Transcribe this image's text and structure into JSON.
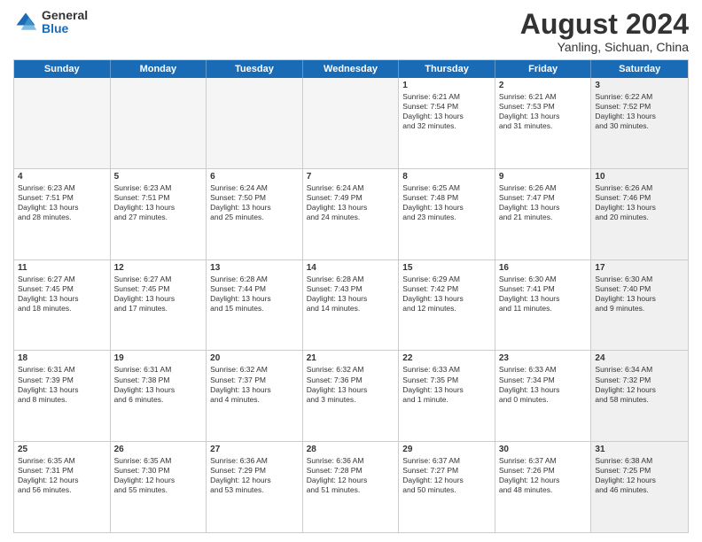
{
  "logo": {
    "general": "General",
    "blue": "Blue"
  },
  "title": "August 2024",
  "location": "Yanling, Sichuan, China",
  "days_of_week": [
    "Sunday",
    "Monday",
    "Tuesday",
    "Wednesday",
    "Thursday",
    "Friday",
    "Saturday"
  ],
  "rows": [
    [
      {
        "day": "",
        "text": "",
        "empty": true
      },
      {
        "day": "",
        "text": "",
        "empty": true
      },
      {
        "day": "",
        "text": "",
        "empty": true
      },
      {
        "day": "",
        "text": "",
        "empty": true
      },
      {
        "day": "1",
        "text": "Sunrise: 6:21 AM\nSunset: 7:54 PM\nDaylight: 13 hours\nand 32 minutes."
      },
      {
        "day": "2",
        "text": "Sunrise: 6:21 AM\nSunset: 7:53 PM\nDaylight: 13 hours\nand 31 minutes."
      },
      {
        "day": "3",
        "text": "Sunrise: 6:22 AM\nSunset: 7:52 PM\nDaylight: 13 hours\nand 30 minutes.",
        "shaded": true
      }
    ],
    [
      {
        "day": "4",
        "text": "Sunrise: 6:23 AM\nSunset: 7:51 PM\nDaylight: 13 hours\nand 28 minutes."
      },
      {
        "day": "5",
        "text": "Sunrise: 6:23 AM\nSunset: 7:51 PM\nDaylight: 13 hours\nand 27 minutes."
      },
      {
        "day": "6",
        "text": "Sunrise: 6:24 AM\nSunset: 7:50 PM\nDaylight: 13 hours\nand 25 minutes."
      },
      {
        "day": "7",
        "text": "Sunrise: 6:24 AM\nSunset: 7:49 PM\nDaylight: 13 hours\nand 24 minutes."
      },
      {
        "day": "8",
        "text": "Sunrise: 6:25 AM\nSunset: 7:48 PM\nDaylight: 13 hours\nand 23 minutes."
      },
      {
        "day": "9",
        "text": "Sunrise: 6:26 AM\nSunset: 7:47 PM\nDaylight: 13 hours\nand 21 minutes."
      },
      {
        "day": "10",
        "text": "Sunrise: 6:26 AM\nSunset: 7:46 PM\nDaylight: 13 hours\nand 20 minutes.",
        "shaded": true
      }
    ],
    [
      {
        "day": "11",
        "text": "Sunrise: 6:27 AM\nSunset: 7:45 PM\nDaylight: 13 hours\nand 18 minutes."
      },
      {
        "day": "12",
        "text": "Sunrise: 6:27 AM\nSunset: 7:45 PM\nDaylight: 13 hours\nand 17 minutes."
      },
      {
        "day": "13",
        "text": "Sunrise: 6:28 AM\nSunset: 7:44 PM\nDaylight: 13 hours\nand 15 minutes."
      },
      {
        "day": "14",
        "text": "Sunrise: 6:28 AM\nSunset: 7:43 PM\nDaylight: 13 hours\nand 14 minutes."
      },
      {
        "day": "15",
        "text": "Sunrise: 6:29 AM\nSunset: 7:42 PM\nDaylight: 13 hours\nand 12 minutes."
      },
      {
        "day": "16",
        "text": "Sunrise: 6:30 AM\nSunset: 7:41 PM\nDaylight: 13 hours\nand 11 minutes."
      },
      {
        "day": "17",
        "text": "Sunrise: 6:30 AM\nSunset: 7:40 PM\nDaylight: 13 hours\nand 9 minutes.",
        "shaded": true
      }
    ],
    [
      {
        "day": "18",
        "text": "Sunrise: 6:31 AM\nSunset: 7:39 PM\nDaylight: 13 hours\nand 8 minutes."
      },
      {
        "day": "19",
        "text": "Sunrise: 6:31 AM\nSunset: 7:38 PM\nDaylight: 13 hours\nand 6 minutes."
      },
      {
        "day": "20",
        "text": "Sunrise: 6:32 AM\nSunset: 7:37 PM\nDaylight: 13 hours\nand 4 minutes."
      },
      {
        "day": "21",
        "text": "Sunrise: 6:32 AM\nSunset: 7:36 PM\nDaylight: 13 hours\nand 3 minutes."
      },
      {
        "day": "22",
        "text": "Sunrise: 6:33 AM\nSunset: 7:35 PM\nDaylight: 13 hours\nand 1 minute."
      },
      {
        "day": "23",
        "text": "Sunrise: 6:33 AM\nSunset: 7:34 PM\nDaylight: 13 hours\nand 0 minutes."
      },
      {
        "day": "24",
        "text": "Sunrise: 6:34 AM\nSunset: 7:32 PM\nDaylight: 12 hours\nand 58 minutes.",
        "shaded": true
      }
    ],
    [
      {
        "day": "25",
        "text": "Sunrise: 6:35 AM\nSunset: 7:31 PM\nDaylight: 12 hours\nand 56 minutes."
      },
      {
        "day": "26",
        "text": "Sunrise: 6:35 AM\nSunset: 7:30 PM\nDaylight: 12 hours\nand 55 minutes."
      },
      {
        "day": "27",
        "text": "Sunrise: 6:36 AM\nSunset: 7:29 PM\nDaylight: 12 hours\nand 53 minutes."
      },
      {
        "day": "28",
        "text": "Sunrise: 6:36 AM\nSunset: 7:28 PM\nDaylight: 12 hours\nand 51 minutes."
      },
      {
        "day": "29",
        "text": "Sunrise: 6:37 AM\nSunset: 7:27 PM\nDaylight: 12 hours\nand 50 minutes."
      },
      {
        "day": "30",
        "text": "Sunrise: 6:37 AM\nSunset: 7:26 PM\nDaylight: 12 hours\nand 48 minutes."
      },
      {
        "day": "31",
        "text": "Sunrise: 6:38 AM\nSunset: 7:25 PM\nDaylight: 12 hours\nand 46 minutes.",
        "shaded": true
      }
    ]
  ]
}
